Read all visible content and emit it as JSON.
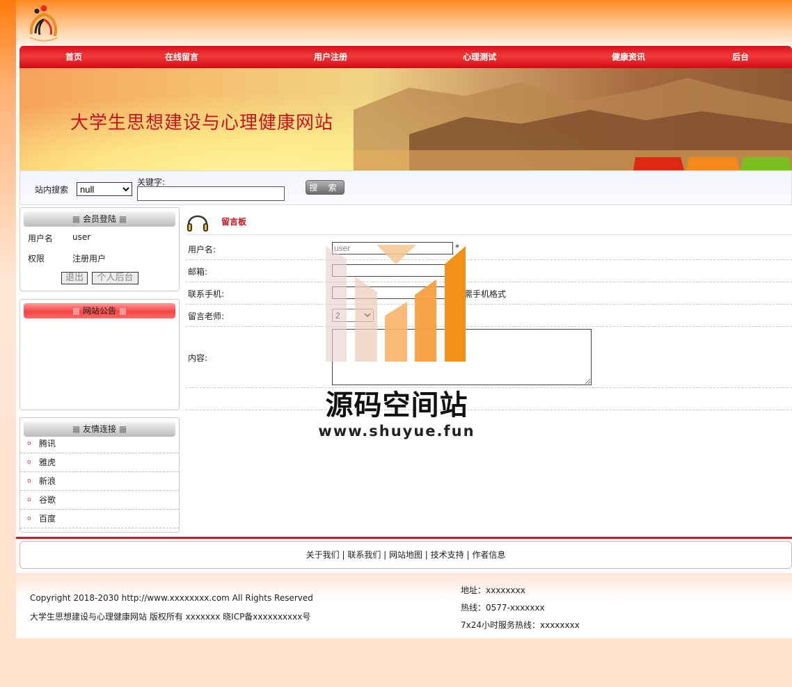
{
  "nav": {
    "items": [
      "首页",
      "在线留言",
      "用户注册",
      "心理测试",
      "健康资讯",
      "后台"
    ]
  },
  "banner": {
    "title": "大学生思想建设与心理健康网站"
  },
  "search": {
    "label": "站内搜索",
    "select_value": "null",
    "keyword_label": "关键字:",
    "keyword_value": "",
    "button_label": "搜 索"
  },
  "login_box": {
    "title": "会员登陆",
    "username_label": "用户名",
    "username_value": "user",
    "role_label": "权限",
    "role_value": "注册用户",
    "logout_label": "退出",
    "backend_label": "个人后台"
  },
  "notice_box": {
    "title": "网站公告"
  },
  "links_box": {
    "title": "友情连接",
    "links": [
      "腾讯",
      "雅虎",
      "新浪",
      "谷歌",
      "百度"
    ]
  },
  "guestbook": {
    "title": "留言板",
    "username_label": "用户名:",
    "username_value": "user",
    "required_mark": "*",
    "email_label": "邮箱:",
    "phone_label": "联系手机:",
    "phone_hint": "需手机格式",
    "teacher_label": "留言老师:",
    "teacher_value": "2",
    "content_label": "内容:"
  },
  "footer": {
    "links_text": "关于我们 | 联系我们 | 网站地图 | 技术支持 | 作者信息",
    "copyright": "Copyright 2018-2030 http://www.xxxxxxxx.com All Rights Reserved",
    "rights": "大学生思想建设与心理健康网站 版权所有 xxxxxxx 晓ICP备xxxxxxxxxx号",
    "address": "地址：xxxxxxxx",
    "hotline": "热线：0577-xxxxxxx",
    "service": "7x24小时服务热线：xxxxxxxx"
  },
  "watermark": {
    "text": "源码空间站",
    "url": "www.shuyue.fun"
  },
  "colors": {
    "nav_red": "#d8101a",
    "accent_red": "#c8141c",
    "orange": "#ff7a0a",
    "watermark_orange": "#f39019"
  }
}
